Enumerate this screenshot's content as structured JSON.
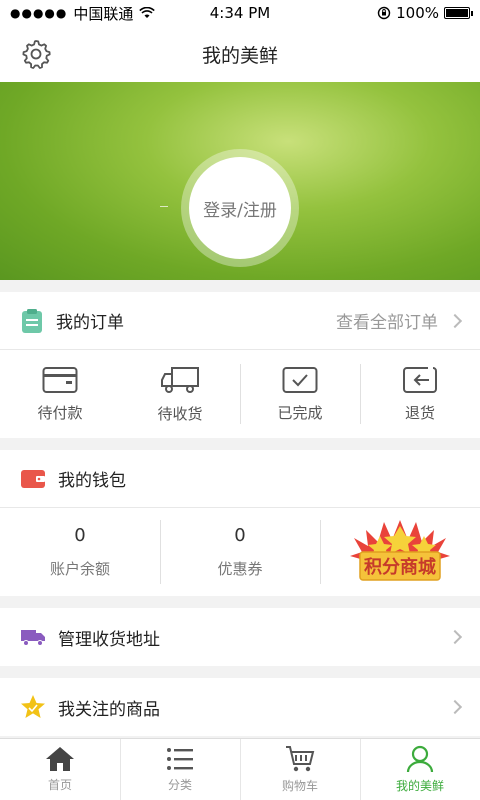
{
  "status": {
    "carrier": "中国联通",
    "signal_dots": "●●●●●",
    "time": "4:34 PM",
    "battery": "100%"
  },
  "nav": {
    "title": "我的美鲜"
  },
  "hero": {
    "login_label": "登录/注册"
  },
  "orders": {
    "title": "我的订单",
    "view_all": "查看全部订单",
    "items": [
      {
        "label": "待付款",
        "icon": "wallet-icon"
      },
      {
        "label": "待收货",
        "icon": "truck-icon"
      },
      {
        "label": "已完成",
        "icon": "check-box-icon"
      },
      {
        "label": "退货",
        "icon": "return-icon"
      }
    ]
  },
  "wallet": {
    "title": "我的钱包",
    "balance": {
      "value": "0",
      "label": "账户余额"
    },
    "coupon": {
      "value": "0",
      "label": "优惠券"
    },
    "points_mall": "积分商城"
  },
  "address": {
    "label": "管理收货地址"
  },
  "favorites": {
    "label": "我关注的商品"
  },
  "tabs": [
    {
      "label": "首页",
      "icon": "home-icon"
    },
    {
      "label": "分类",
      "icon": "list-icon"
    },
    {
      "label": "购物车",
      "icon": "cart-icon"
    },
    {
      "label": "我的美鲜",
      "icon": "user-icon"
    }
  ],
  "colors": {
    "accent": "#3cab3c",
    "order_icon": "#6ec8a8",
    "wallet_icon": "#e9564a",
    "truck_icon": "#8a5bbf",
    "star_icon": "#f2c216"
  }
}
